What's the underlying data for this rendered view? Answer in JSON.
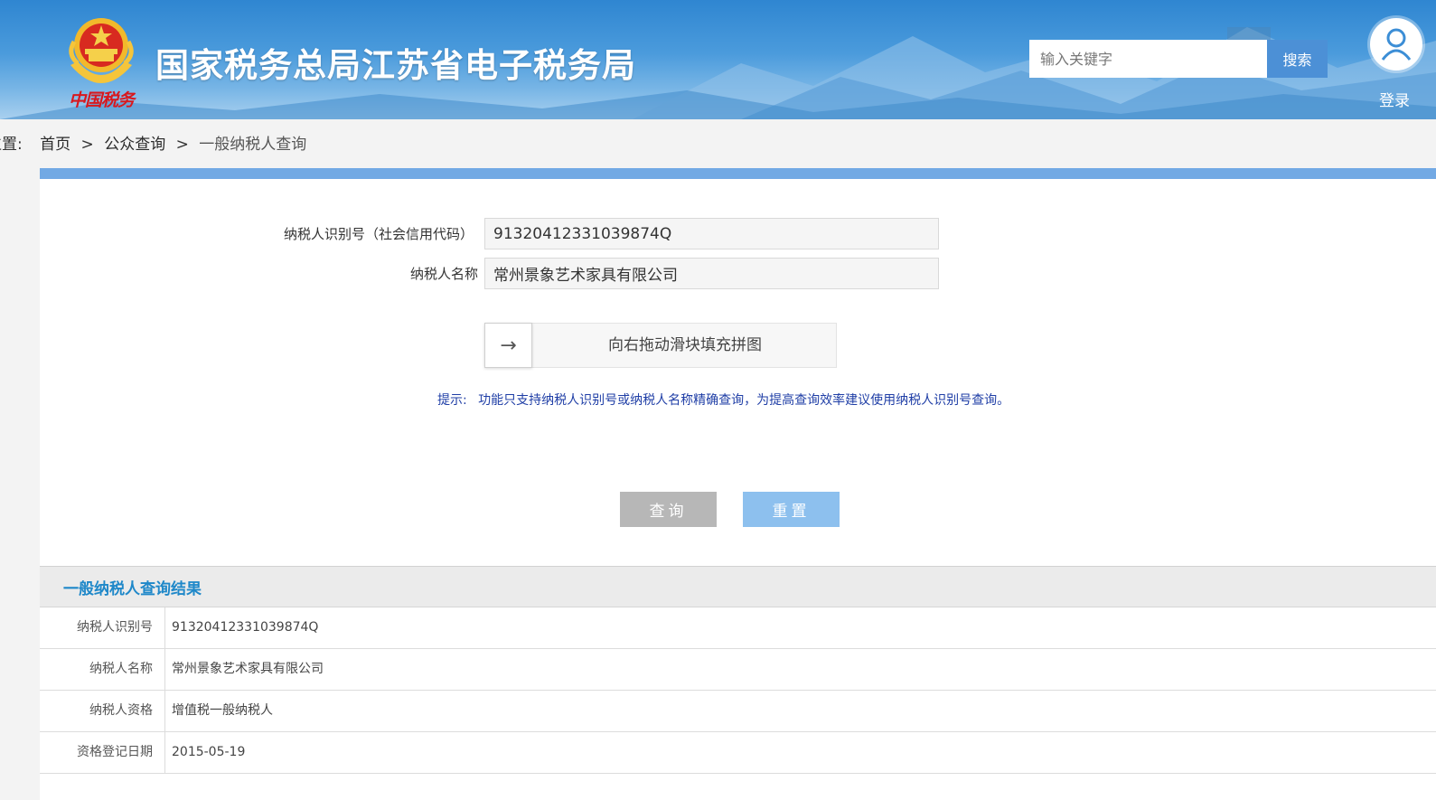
{
  "header": {
    "site_title": "国家税务总局江苏省电子税务局",
    "brand_script": "中国税务",
    "search_placeholder": "输入关键字",
    "search_button": "搜索",
    "login_label": "登录"
  },
  "breadcrumb": {
    "prefix": "位置:",
    "items": [
      "首页",
      "公众查询",
      "一般纳税人查询"
    ],
    "separator": ">"
  },
  "form": {
    "taxpayer_id_label": "纳税人识别号（社会信用代码）",
    "taxpayer_id_value": "91320412331039874Q",
    "taxpayer_name_label": "纳税人名称",
    "taxpayer_name_value": "常州景象艺术家具有限公司",
    "slider_arrow": "→",
    "slider_text": "向右拖动滑块填充拼图",
    "hint_label": "提示:",
    "hint_text": "功能只支持纳税人识别号或纳税人名称精确查询，为提高查询效率建议使用纳税人识别号查询。",
    "query_button": "查询",
    "reset_button": "重置"
  },
  "results": {
    "title": "一般纳税人查询结果",
    "rows": [
      {
        "key": "纳税人识别号",
        "value": "91320412331039874Q"
      },
      {
        "key": "纳税人名称",
        "value": "常州景象艺术家具有限公司"
      },
      {
        "key": "纳税人资格",
        "value": "增值税一般纳税人"
      },
      {
        "key": "资格登记日期",
        "value": "2015-05-19"
      }
    ]
  },
  "colors": {
    "header_blue": "#2f86d1",
    "panel_accent": "#72a9e4",
    "hint_blue": "#1f3ea6",
    "result_title": "#1f88c9",
    "query_button_bg": "#b7b7b7",
    "reset_button_bg": "#8dc0ee"
  }
}
